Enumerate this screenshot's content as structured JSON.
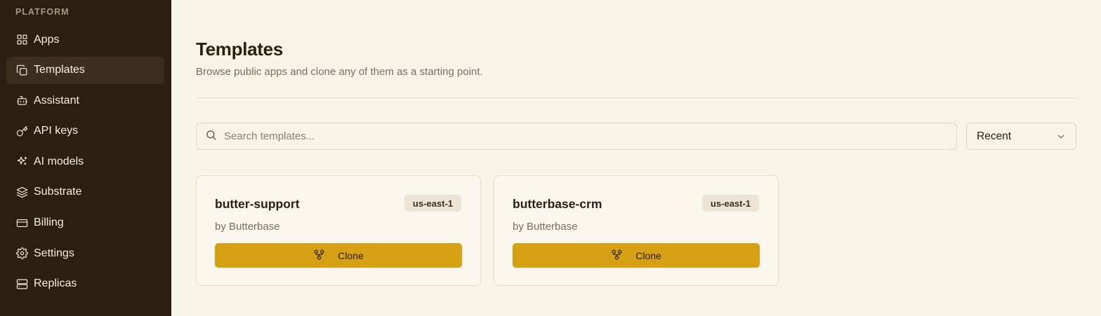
{
  "sidebar": {
    "section_label": "PLATFORM",
    "items": [
      {
        "label": "Apps",
        "icon": "grid-icon"
      },
      {
        "label": "Templates",
        "icon": "copy-icon",
        "active": true
      },
      {
        "label": "Assistant",
        "icon": "bot-icon"
      },
      {
        "label": "API keys",
        "icon": "key-icon"
      },
      {
        "label": "AI models",
        "icon": "sparkles-icon"
      },
      {
        "label": "Substrate",
        "icon": "layers-icon"
      },
      {
        "label": "Billing",
        "icon": "credit-card-icon"
      },
      {
        "label": "Settings",
        "icon": "gear-icon"
      },
      {
        "label": "Replicas",
        "icon": "server-icon"
      }
    ]
  },
  "main": {
    "title": "Templates",
    "subtitle": "Browse public apps and clone any of them as a starting point.",
    "search": {
      "placeholder": "Search templates...",
      "value": ""
    },
    "sort": {
      "selected": "Recent"
    },
    "cards": [
      {
        "name": "butter-support",
        "author": "by Butterbase",
        "region": "us-east-1",
        "clone_label": "Clone"
      },
      {
        "name": "butterbase-crm",
        "author": "by Butterbase",
        "region": "us-east-1",
        "clone_label": "Clone"
      }
    ]
  },
  "colors": {
    "sidebar_bg": "#2a1f10",
    "page_bg": "#f9f4e8",
    "accent": "#d6a015"
  }
}
